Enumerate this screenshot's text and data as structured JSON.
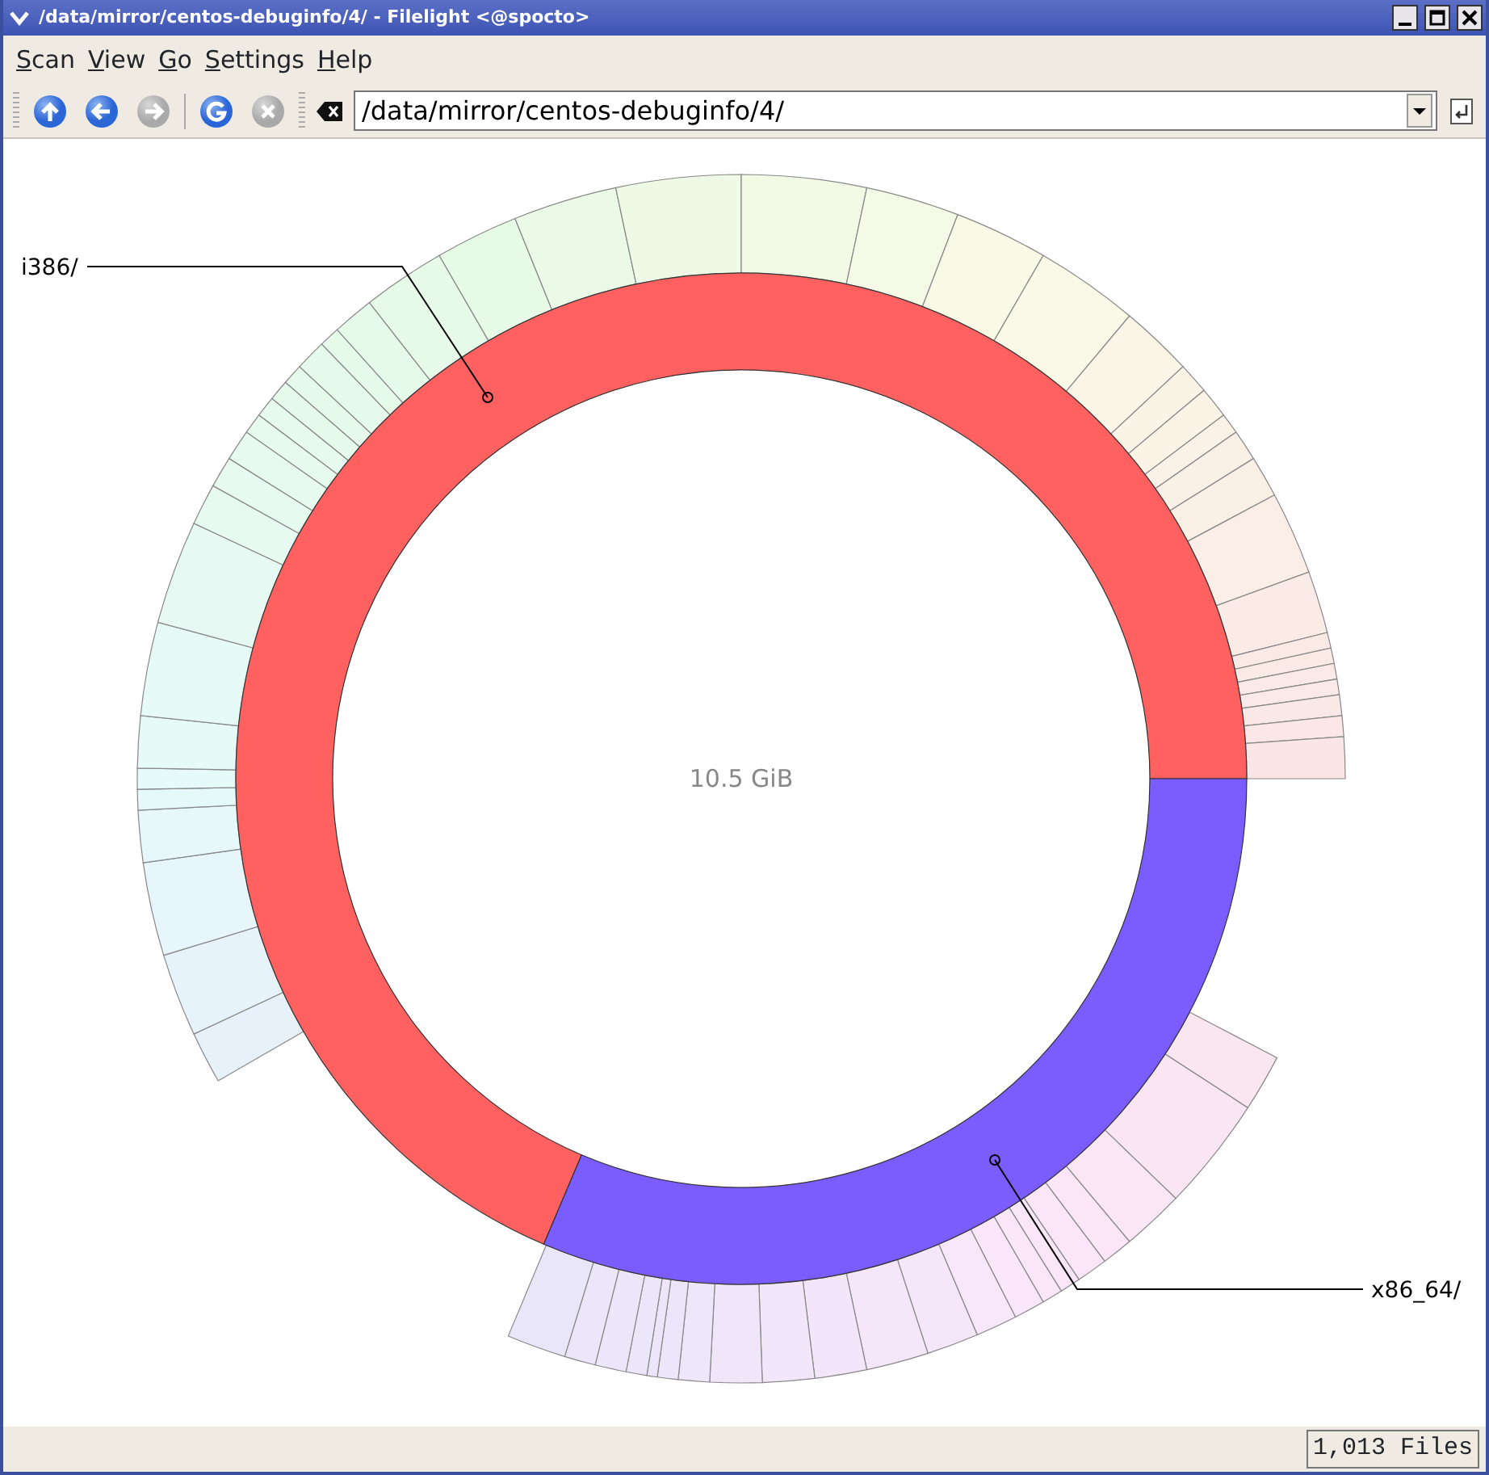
{
  "window": {
    "title": "/data/mirror/centos-debuginfo/4/ - Filelight <@spocto>"
  },
  "menu": [
    "Scan",
    "View",
    "Go",
    "Settings",
    "Help"
  ],
  "toolbar": {
    "buttons": [
      {
        "kind": "up",
        "disabled": false
      },
      {
        "kind": "back",
        "disabled": false
      },
      {
        "kind": "forward",
        "disabled": true
      },
      {
        "kind": "refresh",
        "disabled": false
      },
      {
        "kind": "stop",
        "disabled": true
      }
    ],
    "location": {
      "value": "/data/mirror/centos-debuginfo/4/"
    }
  },
  "chart": {
    "total": "10.5 GiB",
    "segments": [
      {
        "label": "i386/",
        "color": "#ff6060"
      },
      {
        "label": "x86_64/",
        "color": "#7b5cff"
      }
    ]
  },
  "status_bar": {
    "files": "1,013 Files"
  }
}
